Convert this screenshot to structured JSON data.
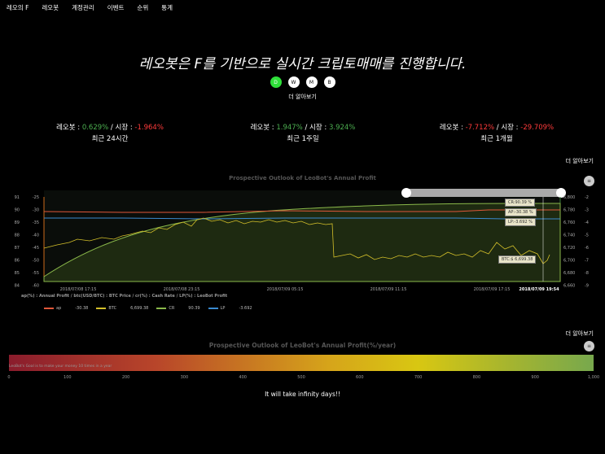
{
  "nav": [
    "레오의 F",
    "레오봇",
    "계정관리",
    "이벤트",
    "순위",
    "통계"
  ],
  "headline": "레오봇은 F를 기반으로 실시간 크립토매매를 진행합니다.",
  "toggles": [
    "D",
    "W",
    "M",
    "B"
  ],
  "toggle_active": "D",
  "more_label": "더 알아보기",
  "stats": [
    {
      "bot_label": "레오봇 : ",
      "bot_value": "0.629%",
      "sep": " / 시장 : ",
      "market_value": "-1.964%",
      "period": "최근 24시간",
      "bot_color": "pos",
      "market_color": "neg"
    },
    {
      "bot_label": "레오봇 : ",
      "bot_value": "1.947%",
      "sep": " / 시장 : ",
      "market_value": "3.924%",
      "period": "최근 1주일",
      "bot_color": "pos",
      "market_color": "pos"
    },
    {
      "bot_label": "레오봇 : ",
      "bot_value": "-7.712%",
      "sep": " / 시장 : ",
      "market_value": "-29.709%",
      "period": "최근 1개월",
      "bot_color": "neg",
      "market_color": "neg"
    }
  ],
  "chart1": {
    "title": "Prospective Outlook of LeoBot's Annual Profit",
    "description": "ap(%) : Annual Profit / btc(USD/BTC) : BTC Price / cr(%) : Cash Rate / LP(%) : LeoBot Profit",
    "x_labels": [
      "2018/07/08 17:15",
      "2018/07/08 23:15",
      "2018/07/09 05:15",
      "2018/07/09 11:15",
      "2018/07/09 17:15"
    ],
    "cursor_label": "2018/07/09 19:54",
    "y_left1": [
      "91",
      "90",
      "89",
      "88",
      "87",
      "86",
      "85",
      "84"
    ],
    "y_left2": [
      "-25",
      "-30",
      "-35",
      "-40",
      "-45",
      "-50",
      "-55",
      "-60"
    ],
    "y_right1": [
      "6,800",
      "6,780",
      "6,760",
      "6,740",
      "6,720",
      "6,700",
      "6,680",
      "6,660"
    ],
    "y_right2": [
      "-2",
      "-3",
      "-4",
      "-5",
      "-6",
      "-7",
      "-8",
      "-9"
    ],
    "tooltips": {
      "cr": "CR:90.39 %",
      "ap": "AP:-30.38 %",
      "lp": "LP:-3.692 %",
      "btc": "BTC:$ 6,699.38"
    },
    "legend": [
      {
        "name": "ap",
        "value": "-30.38",
        "color": "#e0573a"
      },
      {
        "name": "BTC",
        "value": "6,699.38",
        "color": "#d4c02a"
      },
      {
        "name": "CR",
        "value": "90.39",
        "color": "#8ab84a"
      },
      {
        "name": "LP",
        "value": "-3.692",
        "color": "#3a8ad0"
      }
    ]
  },
  "chart2": {
    "title": "Prospective Outlook of LeoBot's Annual Profit(%/year)",
    "goal_text": "LeoBot's Goal is to make your money 10 times in a year",
    "ticks": [
      "0",
      "100",
      "200",
      "300",
      "400",
      "500",
      "600",
      "700",
      "800",
      "900",
      "1,000"
    ],
    "footer": "It will take infinity days!!"
  }
}
